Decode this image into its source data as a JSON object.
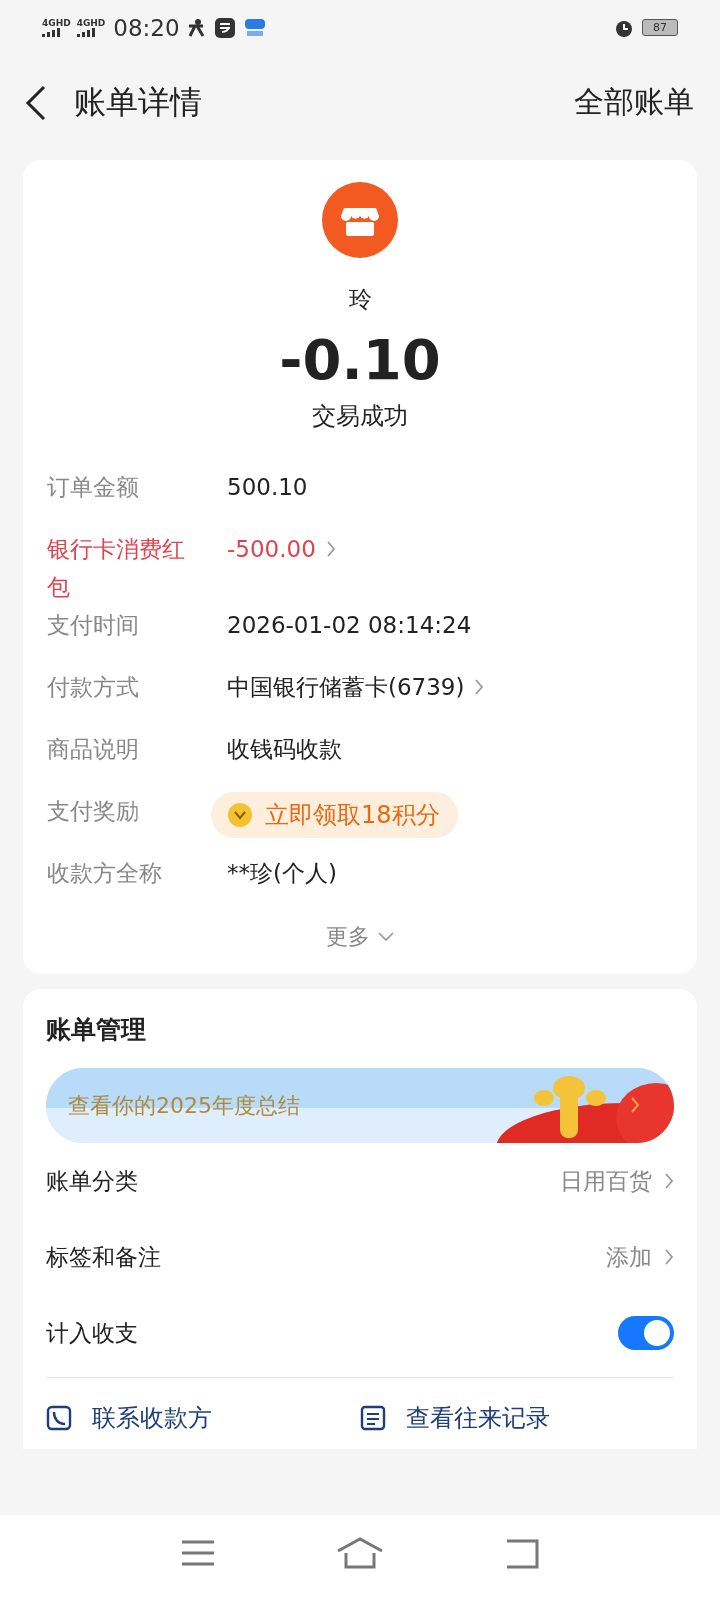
{
  "status_bar": {
    "networks": [
      "4GHD",
      "4GHD"
    ],
    "time": "08:20",
    "battery": "87"
  },
  "header": {
    "title": "账单详情",
    "action": "全部账单"
  },
  "summary": {
    "merchant": "玲",
    "amount": "-0.10",
    "status": "交易成功"
  },
  "details": [
    {
      "kind": "text",
      "label": "订单金额",
      "value": "500.10",
      "highlight": false,
      "link": false
    },
    {
      "kind": "text",
      "label": "银行卡消费红包",
      "value": "-500.00",
      "highlight": true,
      "link": true
    },
    {
      "kind": "text",
      "label": "支付时间",
      "value": "2026-01-02 08:14:24",
      "highlight": false,
      "link": false
    },
    {
      "kind": "text",
      "label": "付款方式",
      "value": "中国银行储蓄卡(6739)",
      "highlight": false,
      "link": true
    },
    {
      "kind": "text",
      "label": "商品说明",
      "value": "收钱码收款",
      "highlight": false,
      "link": false
    },
    {
      "kind": "reward",
      "label": "支付奖励",
      "value": "立即领取18积分",
      "highlight": false,
      "link": false
    },
    {
      "kind": "text",
      "label": "收款方全称",
      "value": "**珍(个人)",
      "highlight": false,
      "link": false
    }
  ],
  "more": "更多",
  "management": {
    "title": "账单管理",
    "banner": "查看你的2025年度总结",
    "rows": [
      {
        "kind": "link",
        "label": "账单分类",
        "value": "日用百货"
      },
      {
        "kind": "link",
        "label": "标签和备注",
        "value": "添加"
      },
      {
        "kind": "toggle",
        "label": "计入收支",
        "on": true
      }
    ],
    "actions": [
      {
        "kind": "phone",
        "label": "联系收款方"
      },
      {
        "kind": "list",
        "label": "查看往来记录"
      }
    ]
  }
}
